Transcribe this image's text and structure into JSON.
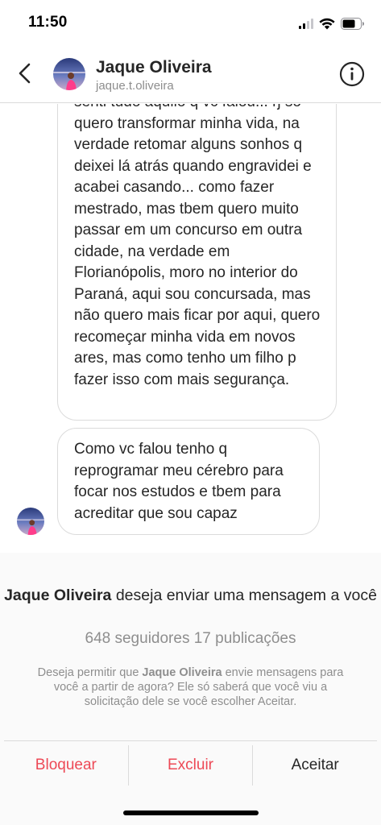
{
  "status_bar": {
    "time": "11:50",
    "icons": [
      "signal-icon",
      "wifi-icon",
      "battery-icon"
    ]
  },
  "header": {
    "back_icon": "chevron-left-icon",
    "name": "Jaque Oliveira",
    "username": "jaque.t.oliveira",
    "info_icon": "info-icon"
  },
  "messages": [
    {
      "text": "senti tudo aquilo q vc falou... rj só quero transformar minha vida, na verdade retomar alguns sonhos q deixei lá atrás quando engravidei e acabei casando... como fazer mestrado, mas tbem quero muito passar em um concurso em outra cidade, na verdade em Florianópolis, moro no interior do Paraná, aqui sou concursada, mas não quero mais ficar por aqui, quero recomeçar minha vida em novos ares, mas como tenho um filho p fazer isso com mais segurança."
    },
    {
      "text": "Como vc falou tenho q reprogramar meu cérebro para focar nos estudos e tbem para acreditar que sou capaz"
    }
  ],
  "request": {
    "name": "Jaque Oliveira",
    "title_rest": " deseja enviar uma mensagem a você",
    "stats": "648 seguidores 17 publicações",
    "desc_prefix": "Deseja permitir que ",
    "desc_name": "Jaque Oliveira",
    "desc_suffix": " envie mensagens para você a partir de agora? Ele só saberá que você viu a solicitação dele se você escolher Aceitar."
  },
  "actions": {
    "block": "Bloquear",
    "delete": "Excluir",
    "accept": "Aceitar"
  },
  "colors": {
    "danger": "#ed4956",
    "text": "#262626",
    "secondary": "#8e8e8e",
    "border": "#dbdbdb",
    "panel": "#fafafa"
  }
}
